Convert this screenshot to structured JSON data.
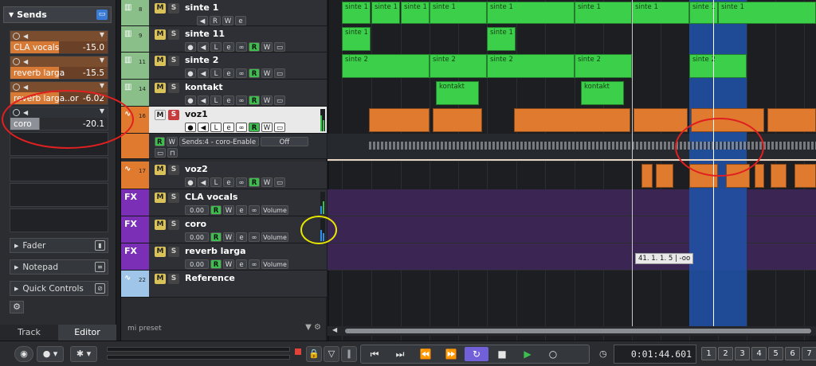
{
  "inspector": {
    "sends_title": "Sends",
    "sends": [
      {
        "name": "CLA vocals",
        "value": "-15.0",
        "style": "orange"
      },
      {
        "name": "reverb larga",
        "value": "-15.5",
        "style": "orange"
      },
      {
        "name": "reverb larga..or",
        "value": "-6.02",
        "style": "orange"
      },
      {
        "name": "coro",
        "value": "-20.1",
        "style": "grey"
      }
    ],
    "sections": [
      "Fader",
      "Notepad",
      "Quick Controls"
    ],
    "tabs": [
      "Track",
      "Editor"
    ]
  },
  "tracks": [
    {
      "num": "8",
      "name": "sinte 1",
      "color": "#8bbf8a"
    },
    {
      "num": "9",
      "name": "sinte 11",
      "color": "#8bbf8a"
    },
    {
      "num": "11",
      "name": "sinte 2",
      "color": "#8bbf8a"
    },
    {
      "num": "14",
      "name": "kontakt",
      "color": "#8bbf8a"
    },
    {
      "num": "16",
      "name": "voz1",
      "color": "#e07a2e"
    },
    {
      "num": "17",
      "name": "voz2",
      "color": "#e07a2e"
    },
    {
      "num": "",
      "name": "CLA vocals",
      "color": "#7b2fb6"
    },
    {
      "num": "",
      "name": "coro",
      "color": "#7b2fb6"
    },
    {
      "num": "",
      "name": "reverb larga",
      "color": "#7b2fb6"
    },
    {
      "num": "22",
      "name": "Reference",
      "color": "#9fc5e8"
    }
  ],
  "lane": {
    "text": "Sends:4 - coro-Enable",
    "value": "Off"
  },
  "fx_value": "0.00",
  "fx_label": "FX",
  "volume_label": "Volume",
  "preset": "mi preset",
  "arrange": {
    "labels": {
      "sinte1": "sinte 1",
      "sinte11": "sinte 1",
      "sinte2": "sinte 2",
      "kontakt": "kontakt"
    },
    "tooltip": "41. 1. 1. 5 | -oo"
  },
  "transport": {
    "time": "0:01:44.601",
    "markers": [
      "1",
      "2",
      "3",
      "4",
      "5",
      "6",
      "7"
    ]
  }
}
